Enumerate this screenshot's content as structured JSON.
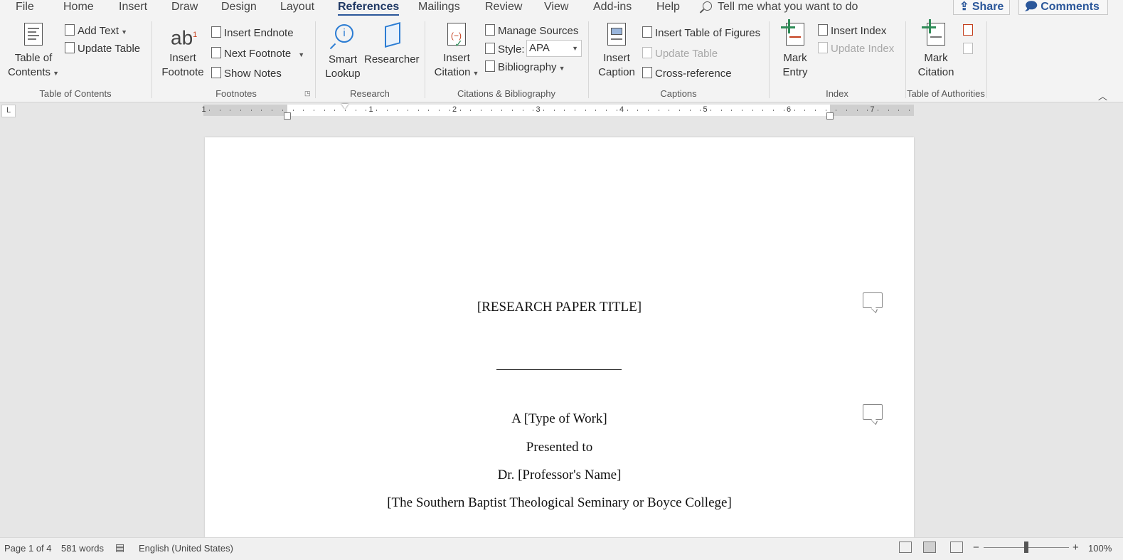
{
  "tabs": [
    "File",
    "Home",
    "Insert",
    "Draw",
    "Design",
    "Layout",
    "References",
    "Mailings",
    "Review",
    "View",
    "Add-ins",
    "Help"
  ],
  "active_tab": "References",
  "tell_me": "Tell me what you want to do",
  "share_label": "Share",
  "comments_label": "Comments",
  "ribbon": {
    "toc": {
      "big_label_line1": "Table of",
      "big_label_line2": "Contents",
      "add_text": "Add Text",
      "update_table": "Update Table",
      "group": "Table of Contents"
    },
    "footnotes": {
      "insert_footnote_line1": "Insert",
      "insert_footnote_line2": "Footnote",
      "insert_endnote": "Insert Endnote",
      "next_footnote": "Next Footnote",
      "show_notes": "Show Notes",
      "group": "Footnotes"
    },
    "research": {
      "smart_lookup_line1": "Smart",
      "smart_lookup_line2": "Lookup",
      "researcher": "Researcher",
      "group": "Research"
    },
    "citations": {
      "insert_citation_line1": "Insert",
      "insert_citation_line2": "Citation",
      "manage_sources": "Manage Sources",
      "style_label": "Style:",
      "style_value": "APA",
      "bibliography": "Bibliography",
      "group": "Citations & Bibliography"
    },
    "captions": {
      "insert_caption_line1": "Insert",
      "insert_caption_line2": "Caption",
      "insert_table_of_figures": "Insert Table of Figures",
      "update_table": "Update Table",
      "cross_reference": "Cross-reference",
      "group": "Captions"
    },
    "index": {
      "mark_entry_line1": "Mark",
      "mark_entry_line2": "Entry",
      "insert_index": "Insert Index",
      "update_index": "Update Index",
      "group": "Index"
    },
    "authorities": {
      "mark_citation_line1": "Mark",
      "mark_citation_line2": "Citation",
      "group": "Table of Authorities"
    }
  },
  "ruler_numbers": [
    "1",
    "1",
    "2",
    "3",
    "4",
    "5",
    "6",
    "7"
  ],
  "document": {
    "title": "[RESEARCH PAPER TITLE]",
    "line1": "A [Type of Work]",
    "line2": "Presented to",
    "line3": "Dr. [Professor's Name]",
    "line4": "[The Southern Baptist Theological Seminary or Boyce College]"
  },
  "status": {
    "page": "Page 1 of 4",
    "words": "581 words",
    "language": "English (United States)",
    "zoom": "100%",
    "zoom_minus": "−",
    "zoom_plus": "+"
  },
  "colors": {
    "accent": "#2b579a",
    "ribbon_bg": "#f3f3f3",
    "canvas_bg": "#e6e6e6"
  }
}
